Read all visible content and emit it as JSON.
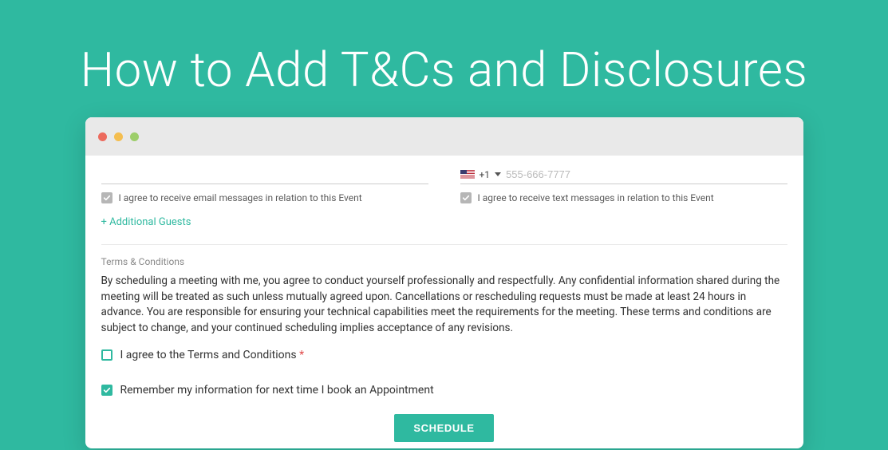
{
  "page": {
    "title": "How to Add T&Cs and Disclosures"
  },
  "phone": {
    "dial_code": "+1",
    "placeholder": "555-666-7777"
  },
  "consent": {
    "email_label": "I agree to receive email messages in relation to this Event",
    "text_label": "I agree to receive text messages in relation to this Event"
  },
  "guests": {
    "add_link": "+ Additional Guests"
  },
  "terms": {
    "section_label": "Terms & Conditions",
    "body": "By scheduling a meeting with me, you agree to conduct yourself professionally and respectfully. Any confidential information shared during the meeting will be treated as such unless mutually agreed upon. Cancellations or rescheduling requests must be made at least 24 hours in advance. You are responsible for ensuring your technical capabilities meet the requirements for the meeting. These terms and conditions are subject to change, and your continued scheduling implies acceptance of any revisions.",
    "agree_label": "I agree to the Terms and Conditions",
    "required_mark": "*"
  },
  "remember": {
    "label": "Remember my information for next time I book an Appointment"
  },
  "actions": {
    "schedule": "SCHEDULE"
  }
}
